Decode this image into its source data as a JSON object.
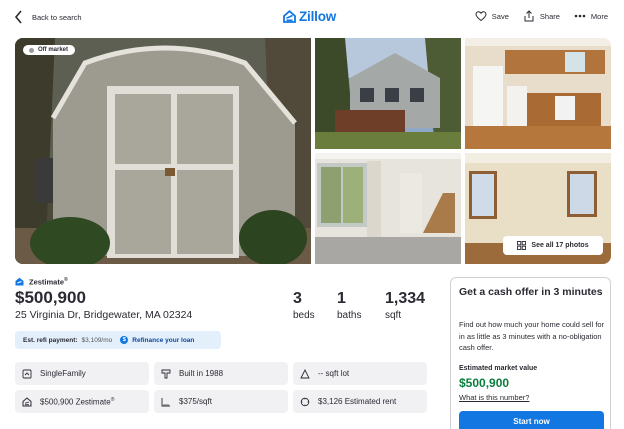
{
  "header": {
    "back_label": "Back to search",
    "brand": "Zillow",
    "save_label": "Save",
    "share_label": "Share",
    "more_label": "More"
  },
  "gallery": {
    "badge": "Off market",
    "see_all": "See all 17 photos"
  },
  "summary": {
    "zestimate_label": "Zestimate",
    "zestimate_mark": "®",
    "price": "$500,900",
    "address": "25 Virginia Dr, Bridgewater, MA 02324",
    "beds": {
      "value": "3",
      "label": "beds"
    },
    "baths": {
      "value": "1",
      "label": "baths"
    },
    "sqft": {
      "value": "1,334",
      "label": "sqft"
    }
  },
  "refi": {
    "label": "Est. refi payment:",
    "amount": "$3,109/mo",
    "link": "Refinance your loan"
  },
  "facts": {
    "type": "SingleFamily",
    "built": "Built in 1988",
    "lot": "-- sqft lot",
    "zestimate": "$500,900 Zestimate",
    "zestimate_mark": "®",
    "price_per_sqft": "$375/sqft",
    "rent": "$3,126 Estimated rent"
  },
  "cash_offer": {
    "title": "Get a cash offer in 3 minutes",
    "description": "Find out how much your home could sell for in as little as 3 minutes with a no-obligation cash offer.",
    "estimated_label": "Estimated market value",
    "estimated_value": "$500,900",
    "what_link": "What is this number?",
    "button": "Start now"
  },
  "colors": {
    "brand_blue": "#1277e1",
    "value_green": "#0a7e3c",
    "refi_bg": "#e3f0fc",
    "fact_bg": "#f1f1f4"
  },
  "icons": [
    "chevron-left-icon",
    "heart-icon",
    "share-icon",
    "more-dots-icon",
    "grid-icon",
    "home-icon",
    "hammer-icon",
    "lot-icon",
    "ruler-icon",
    "rent-icon"
  ]
}
